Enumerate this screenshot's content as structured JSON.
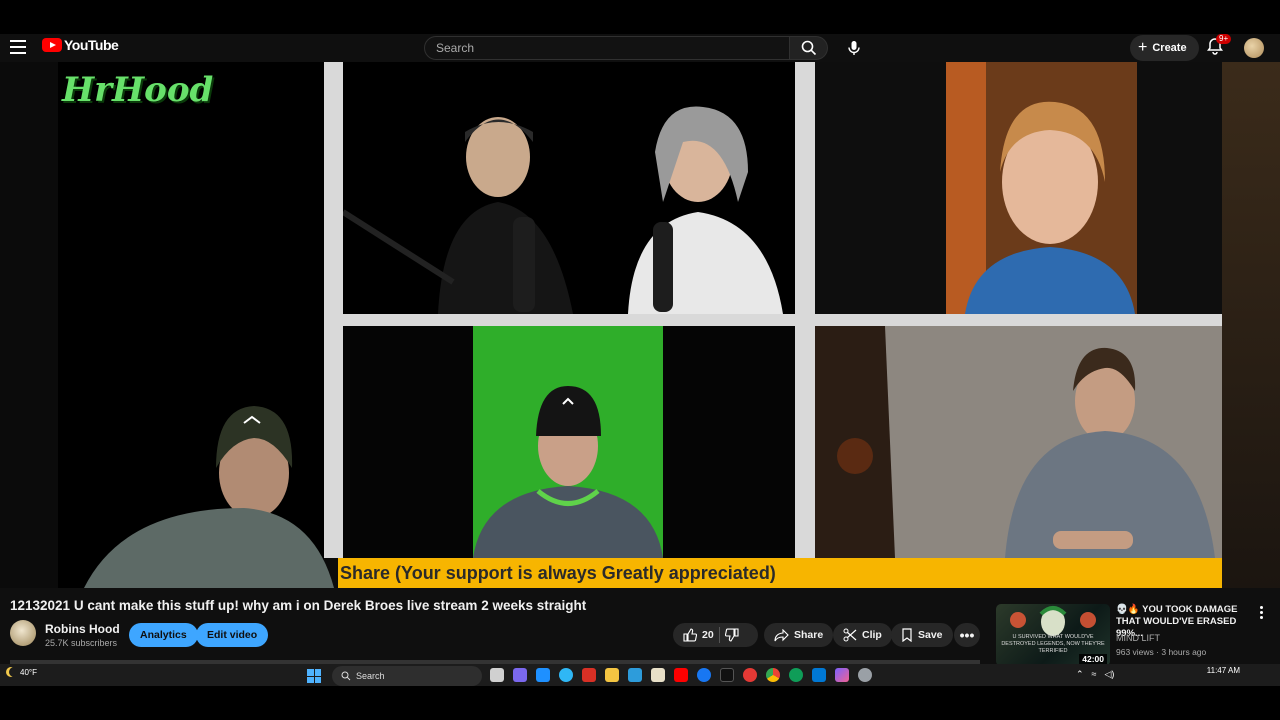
{
  "header": {
    "logo_text": "YouTube",
    "search_placeholder": "Search",
    "create_label": "Create",
    "notification_count": "9+"
  },
  "video": {
    "overlay_logo": "HrHood",
    "banner_text": "Share (Your support is always Greatly appreciated)"
  },
  "details": {
    "title": "12132021 U cant make this stuff up! why am i on Derek Broes live stream 2 weeks straight",
    "channel_name": "Robins Hood",
    "subscribers": "25.7K subscribers",
    "analytics_label": "Analytics",
    "edit_label": "Edit video",
    "like_count": "20",
    "share_label": "Share",
    "clip_label": "Clip",
    "save_label": "Save"
  },
  "recommendation": {
    "title": "💀🔥 YOU TOOK DAMAGE THAT WOULD'VE ERASED 99%...",
    "channel": "MIND LIFT",
    "meta": "963 views · 3 hours ago",
    "duration": "42:00",
    "thumb_caption": "U SURVIVED WHAT WOULD'VE DESTROYED LEGENDS, NOW THEY'RE TERRIFIED"
  },
  "taskbar": {
    "temperature": "40°F",
    "search_label": "Search",
    "time": "11:47 AM"
  },
  "colors": {
    "youtube_red": "#ff0000",
    "accent_blue": "#3ea6ff",
    "banner_yellow": "#f7b500",
    "logo_green": "#67e06a"
  }
}
